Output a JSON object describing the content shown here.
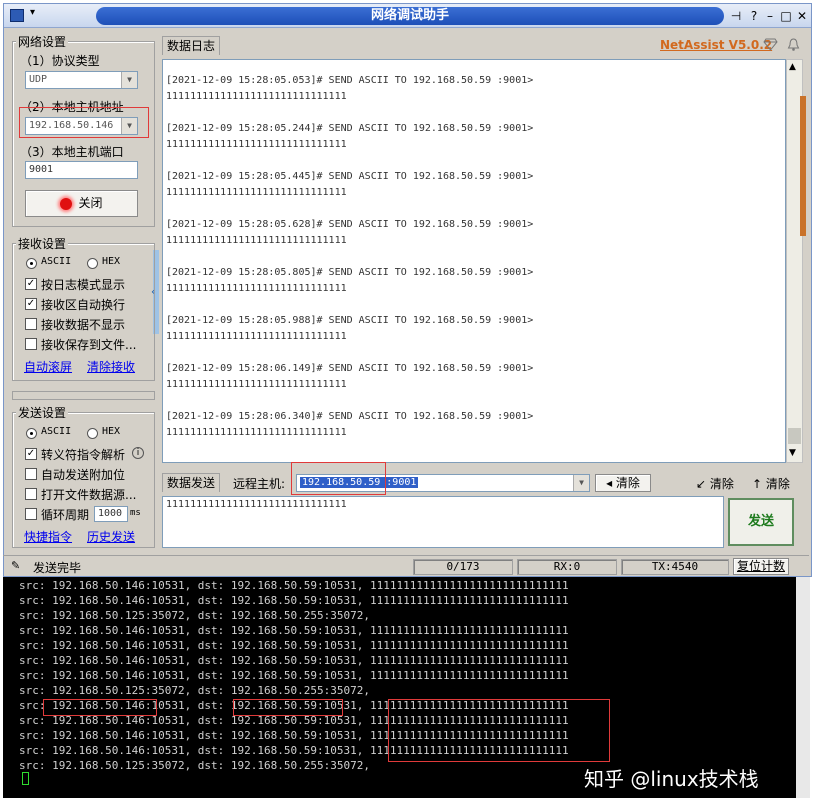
{
  "title": "网络调试助手",
  "brand": {
    "name": "NetAssist V5.0.2",
    "color": "#d2691e"
  },
  "net": {
    "group": "网络设置",
    "protocol_label": "（1）协议类型",
    "protocol_value": "UDP",
    "host_label": "（2）本地主机地址",
    "host_value": "192.168.50.146",
    "port_label": "（3）本地主机端口",
    "port_value": "9001",
    "close_label": "关闭"
  },
  "recv": {
    "group": "接收设置",
    "ascii": "ASCII",
    "hex": "HEX",
    "opt1": "按日志模式显示",
    "opt2": "接收区自动换行",
    "opt3": "接收数据不显示",
    "opt4": "接收保存到文件...",
    "link1": "自动滚屏",
    "link2": "清除接收"
  },
  "send": {
    "group": "发送设置",
    "ascii": "ASCII",
    "hex": "HEX",
    "opt1": "转义符指令解析",
    "opt2": "自动发送附加位",
    "opt3": "打开文件数据源...",
    "opt4": "循环周期",
    "period": "1000",
    "unit": "ms",
    "link1": "快捷指令",
    "link2": "历史发送"
  },
  "log_tab": "数据日志",
  "log": [
    {
      "header": "[2021-12-09 15:28:05.053]# SEND ASCII TO 192.168.50.59 :9001>",
      "data": "111111111111111111111111111111"
    },
    {
      "header": "[2021-12-09 15:28:05.244]# SEND ASCII TO 192.168.50.59 :9001>",
      "data": "111111111111111111111111111111"
    },
    {
      "header": "[2021-12-09 15:28:05.445]# SEND ASCII TO 192.168.50.59 :9001>",
      "data": "111111111111111111111111111111"
    },
    {
      "header": "[2021-12-09 15:28:05.628]# SEND ASCII TO 192.168.50.59 :9001>",
      "data": "111111111111111111111111111111"
    },
    {
      "header": "[2021-12-09 15:28:05.805]# SEND ASCII TO 192.168.50.59 :9001>",
      "data": "111111111111111111111111111111"
    },
    {
      "header": "[2021-12-09 15:28:05.988]# SEND ASCII TO 192.168.50.59 :9001>",
      "data": "111111111111111111111111111111"
    },
    {
      "header": "[2021-12-09 15:28:06.149]# SEND ASCII TO 192.168.50.59 :9001>",
      "data": "111111111111111111111111111111"
    },
    {
      "header": "[2021-12-09 15:28:06.340]# SEND ASCII TO 192.168.50.59 :9001>",
      "data": "111111111111111111111111111111"
    }
  ],
  "sendbar": {
    "tab": "数据发送",
    "remote_label": "远程主机:",
    "remote_value": "192.168.50.59 :9001",
    "clear1": "清除",
    "clear2": "清除",
    "clear3": "清除",
    "content": "111111111111111111111111111111",
    "send_label": "发送"
  },
  "status": {
    "message": "发送完毕",
    "count": "0/173",
    "rx": "RX:0",
    "tx": "TX:4540",
    "reset": "复位计数"
  },
  "terminal_lines": [
    "src: 192.168.50.146:10531, dst: 192.168.50.59:10531, 111111111111111111111111111111",
    "src: 192.168.50.146:10531, dst: 192.168.50.59:10531, 111111111111111111111111111111",
    "src: 192.168.50.125:35072, dst: 192.168.50.255:35072,",
    "src: 192.168.50.146:10531, dst: 192.168.50.59:10531, 111111111111111111111111111111",
    "src: 192.168.50.146:10531, dst: 192.168.50.59:10531, 111111111111111111111111111111",
    "src: 192.168.50.146:10531, dst: 192.168.50.59:10531, 111111111111111111111111111111",
    "src: 192.168.50.146:10531, dst: 192.168.50.59:10531, 111111111111111111111111111111",
    "src: 192.168.50.125:35072, dst: 192.168.50.255:35072,",
    "src: 192.168.50.146:10531, dst: 192.168.50.59:10531, 111111111111111111111111111111",
    "src: 192.168.50.146:10531, dst: 192.168.50.59:10531, 111111111111111111111111111111",
    "src: 192.168.50.146:10531, dst: 192.168.50.59:10531, 111111111111111111111111111111",
    "src: 192.168.50.146:10531, dst: 192.168.50.59:10531, 111111111111111111111111111111",
    "src: 192.168.50.125:35072, dst: 192.168.50.255:35072,"
  ],
  "watermark": "知乎 @linux技术栈"
}
